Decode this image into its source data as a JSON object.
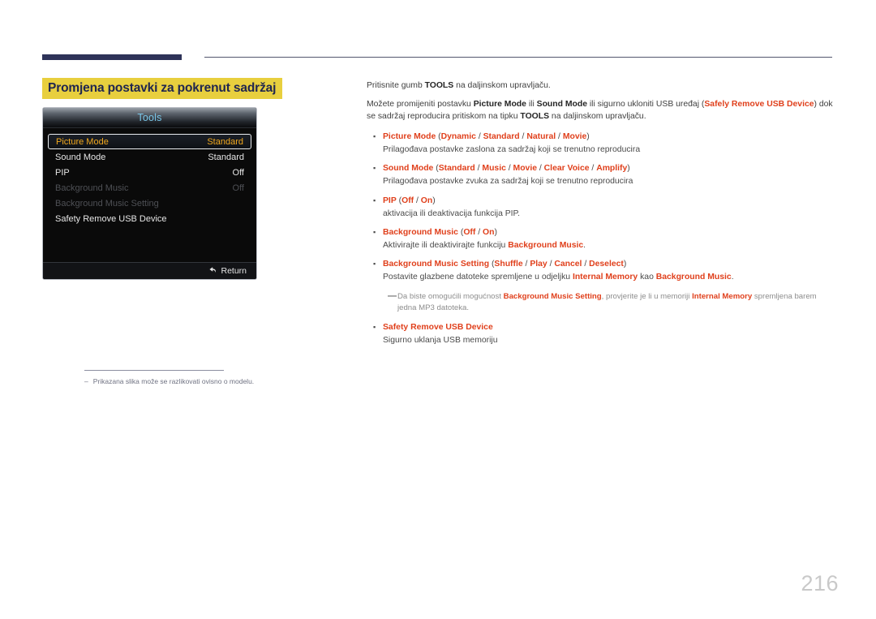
{
  "page": {
    "number": "216",
    "title": "Promjena postavki za pokrenut sadržaj"
  },
  "osd": {
    "header_title": "Tools",
    "rows": [
      {
        "label": "Picture Mode",
        "value": "Standard",
        "state": "selected"
      },
      {
        "label": "Sound Mode",
        "value": "Standard",
        "state": "normal"
      },
      {
        "label": "PIP",
        "value": "Off",
        "state": "normal"
      },
      {
        "label": "Background Music",
        "value": "Off",
        "state": "disabled"
      },
      {
        "label": "Background Music Setting",
        "value": "",
        "state": "disabled"
      },
      {
        "label": "Safety Remove USB Device",
        "value": "",
        "state": "normal"
      }
    ],
    "return_label": "Return",
    "return_icon": "return-arrow-icon"
  },
  "footnote": {
    "dash": "–",
    "text": "Prikazana slika može se razlikovati ovisno o modelu."
  },
  "content": {
    "para1": {
      "pre": "Pritisnite gumb ",
      "key": "TOOLS",
      "post": " na daljinskom upravljaču."
    },
    "para2": {
      "p1": "Možete promijeniti postavku ",
      "k1": "Picture Mode",
      "p2": " ili ",
      "k2": "Sound Mode",
      "p3": " ili sigurno ukloniti USB uređaj (",
      "k3": "Safely Remove USB Device",
      "p4": ") dok se sadržaj reproducira pritiskom na tipku ",
      "k4": "TOOLS",
      "p5": " na daljinskom upravljaču."
    },
    "bullets": [
      {
        "name": "Picture Mode",
        "options": [
          "Dynamic",
          "Standard",
          "Natural",
          "Movie"
        ],
        "desc": "Prilagođava postavke zaslona za sadržaj koji se trenutno reproducira"
      },
      {
        "name": "Sound Mode",
        "options": [
          "Standard",
          "Music",
          "Movie",
          "Clear Voice",
          "Amplify"
        ],
        "desc": "Prilagođava postavke zvuka za sadržaj koji se trenutno reproducira"
      },
      {
        "name": "PIP",
        "options": [
          "Off",
          "On"
        ],
        "desc": "aktivacija ili deaktivacija funkcija PIP."
      },
      {
        "name": "Background Music",
        "options": [
          "Off",
          "On"
        ],
        "desc_pre": "Aktivirajte ili deaktivirajte funkciju ",
        "desc_key": "Background Music",
        "desc_post": "."
      },
      {
        "name": "Background Music Setting",
        "options": [
          "Shuffle",
          "Play",
          "Cancel",
          "Deselect"
        ],
        "desc_pre": "Postavite glazbene datoteke spremljene u odjeljku ",
        "desc_key1": "Internal Memory",
        "desc_mid": " kao ",
        "desc_key2": "Background Music",
        "desc_post": "."
      },
      {
        "name": "Safety Remove USB Device",
        "options": [],
        "desc": "Sigurno uklanja USB memoriju"
      }
    ],
    "note": {
      "dash": "—",
      "p1": "Da biste omogućili mogućnost ",
      "k1": "Background Music Setting",
      "p2": ", provjerite je li u memoriji ",
      "k2": "Internal Memory",
      "p3": " spremljena barem jedna MP3 datoteka."
    }
  },
  "colors": {
    "accent_red": "#e0401c",
    "title_bg": "#e8cf3e",
    "title_fg": "#20264f",
    "rule_navy": "#2e3359",
    "osd_select_fg": "#f0a81e",
    "osd_header_fg": "#79c6e8"
  }
}
